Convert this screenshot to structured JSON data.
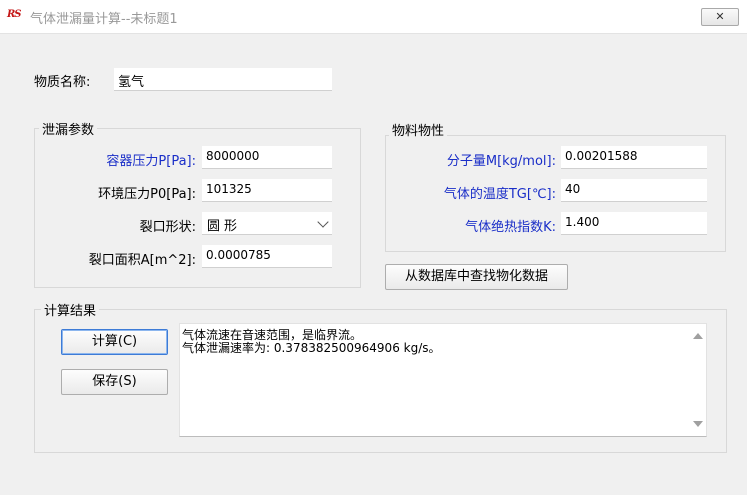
{
  "window": {
    "app_icon": "RS",
    "title": "气体泄漏量计算--未标题1",
    "close_label": "✕"
  },
  "substance": {
    "label": "物质名称:",
    "value": "氢气"
  },
  "leak_params": {
    "title": "泄漏参数",
    "container_pressure": {
      "label": "容器压力P[Pa]:",
      "value": "8000000"
    },
    "ambient_pressure": {
      "label": "环境压力P0[Pa]:",
      "value": "101325"
    },
    "crack_shape": {
      "label": "裂口形状:",
      "value": "圆形"
    },
    "crack_area": {
      "label": "裂口面积A[m^2]:",
      "value": "0.0000785"
    }
  },
  "material_props": {
    "title": "物料物性",
    "molecular_weight": {
      "label": "分子量M[kg/mol]:",
      "value": "0.00201588"
    },
    "gas_temp": {
      "label": "气体的温度TG[℃]:",
      "value": "40"
    },
    "adiabatic_index": {
      "label": "气体绝热指数K:",
      "value": "1.400"
    }
  },
  "lookup_button": "从数据库中查找物化数据",
  "results": {
    "title": "计算结果",
    "calc_button": "计算(C)",
    "save_button": "保存(S)",
    "lines": [
      "气体流速在音速范围，是临界流。",
      "气体泄漏速率为: 0.378382500964906 kg/s。"
    ]
  },
  "colors": {
    "label_blue": "#1a2ec8",
    "app_icon_red": "#c41616",
    "default_button_border": "#3d7bd6"
  }
}
